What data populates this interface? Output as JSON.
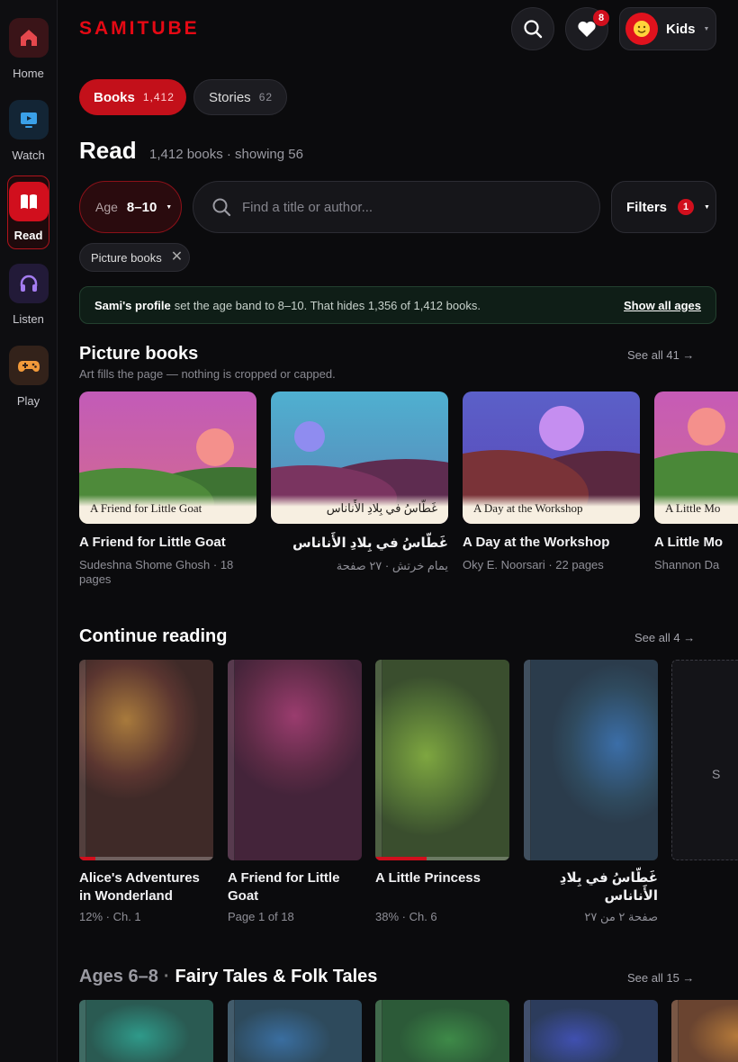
{
  "sidebar": {
    "items": [
      {
        "label": "Home",
        "icon": "home-icon",
        "color": "#e5484d"
      },
      {
        "label": "Watch",
        "icon": "tv-icon",
        "color": "#3aa0e8"
      },
      {
        "label": "Read",
        "icon": "book-icon",
        "color": "#ffffff",
        "active": true
      },
      {
        "label": "Listen",
        "icon": "headphones-icon",
        "color": "#a47cf0"
      },
      {
        "label": "Play",
        "icon": "gamepad-icon",
        "color": "#f29a3a"
      }
    ]
  },
  "header": {
    "brand": "SAMITUBE",
    "favorites_count": "8",
    "profile_name": "Kids"
  },
  "tabs": [
    {
      "label": "Books",
      "count": "1,412",
      "active": true
    },
    {
      "label": "Stories",
      "count": "62",
      "active": false
    }
  ],
  "title": {
    "heading": "Read",
    "summary": "1,412 books · showing 56"
  },
  "filters": {
    "age_label": "Age",
    "age_value": "8–10",
    "search_placeholder": "Find a title or author...",
    "filters_label": "Filters",
    "filters_count": "1",
    "chip_label": "Picture books"
  },
  "notice": {
    "profile": "Sami's profile",
    "message": "set the age band to 8–10. That hides 1,356 of 1,412 books.",
    "action": "Show all ages"
  },
  "picture_books": {
    "title": "Picture books",
    "subtitle": "Art fills the page — nothing is cropped or capped.",
    "see_all": "See all 41 →",
    "items": [
      {
        "cover_text": "A Friend for Little Goat",
        "title": "A Friend for Little Goat",
        "meta": "Sudeshna Shome Ghosh · 18 pages",
        "rtl": false
      },
      {
        "cover_text": "غَطّاسُ في بِلادِ الأَناناس",
        "title": "غَطّاسُ في بِلادِ الأَناناس",
        "meta": "يمام خرتش · ٢٧ صفحة",
        "rtl": true
      },
      {
        "cover_text": "A Day at the Workshop",
        "title": "A Day at the Workshop",
        "meta": "Oky E. Noorsari · 22 pages",
        "rtl": false
      },
      {
        "cover_text": "A Little Mo",
        "title": "A Little Mo",
        "meta": "Shannon Da",
        "rtl": false
      }
    ]
  },
  "continue_reading": {
    "title": "Continue reading",
    "see_all": "See all 4 →",
    "more_label": "S",
    "items": [
      {
        "title": "Alice's Adventures in Wonderland",
        "meta": "12% · Ch. 1",
        "progress": 0.12,
        "rtl": false
      },
      {
        "title": "A Friend for Little Goat",
        "meta": "Page 1 of 18",
        "progress": 0.0,
        "rtl": false
      },
      {
        "title": "A Little Princess",
        "meta": "38% · Ch. 6",
        "progress": 0.38,
        "rtl": false
      },
      {
        "title": "غَطّاسُ في بِلادِ الأَناناس",
        "meta": "صفحة ٢ من ٢٧",
        "progress": 0.0,
        "rtl": true
      }
    ]
  },
  "fairy_tales": {
    "age": "Ages 6–8",
    "separator": "·",
    "name": "Fairy Tales & Folk Tales",
    "see_all": "See all 15 →"
  }
}
